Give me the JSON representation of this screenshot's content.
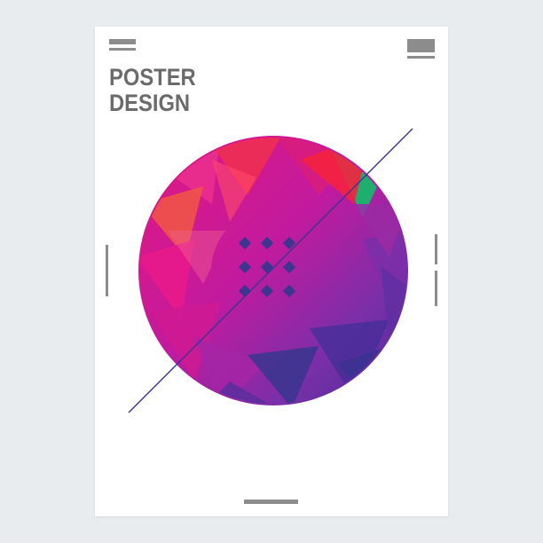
{
  "poster": {
    "title_line1": "POSTER",
    "title_line2": "DESIGN"
  },
  "colors": {
    "background": "#e9ecee",
    "paper": "#ffffff",
    "title": "#6b6b6b",
    "bars": "#8c8c8c",
    "magenta": "#e0178f",
    "violet": "#7a2fa8",
    "indigo": "#4a2f97",
    "red": "#f0304f",
    "green": "#1fae6e",
    "diamond": "#3d3590"
  }
}
